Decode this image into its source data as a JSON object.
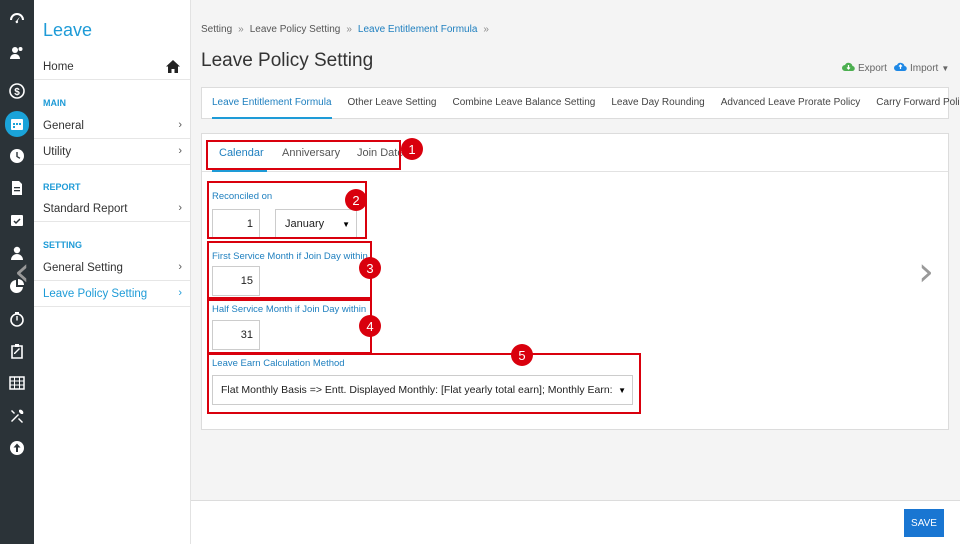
{
  "iconbar": {
    "icons": [
      "dashboard-icon",
      "people-icon",
      "dollar-icon",
      "calendar-icon",
      "clock-icon",
      "document-icon",
      "calendar-check-icon",
      "user-icon",
      "pie-chart-icon",
      "timer-icon",
      "clipboard-icon",
      "grid-icon",
      "tools-icon",
      "arrow-up-circle-icon"
    ],
    "active_index": 3
  },
  "sidebar": {
    "title": "Leave",
    "home": "Home",
    "main_header": "MAIN",
    "main_items": [
      "General",
      "Utility"
    ],
    "report_header": "REPORT",
    "report_items": [
      "Standard Report"
    ],
    "setting_header": "SETTING",
    "setting_items": [
      "General Setting",
      "Leave Policy Setting"
    ],
    "chevron": "›"
  },
  "breadcrumb": {
    "items": [
      "Setting",
      "Leave Policy Setting",
      "Leave Entitlement Formula"
    ],
    "separator": "»"
  },
  "page_title": "Leave Policy Setting",
  "actions": {
    "export_label": "Export",
    "import_label": "Import"
  },
  "tabs": [
    "Leave Entitlement Formula",
    "Other Leave Setting",
    "Combine Leave Balance Setting",
    "Leave Day Rounding",
    "Advanced Leave Prorate Policy",
    "Carry Forward Policy"
  ],
  "subtabs": [
    "Calendar",
    "Anniversary",
    "Join Date"
  ],
  "form": {
    "reconciled_label": "Reconciled on",
    "reconciled_day": "1",
    "reconciled_month": "January",
    "first_service_label": "First Service Month if Join Day within",
    "first_service_value": "15",
    "half_service_label": "Half Service Month if Join Day within",
    "half_service_value": "31",
    "calc_method_label": "Leave Earn Calculation Method",
    "calc_method_value": "Flat Monthly Basis => Entt. Displayed Monthly: [Flat yearly total earn]; Monthly Earn: [Fla"
  },
  "badges": [
    "1",
    "2",
    "3",
    "4",
    "5"
  ],
  "footer": {
    "save_label": "SAVE"
  },
  "nav": {
    "prev": "‹",
    "next": "›"
  },
  "colors": {
    "accent": "#1e9bd7",
    "annotation": "#d9000d",
    "save": "#1976d2",
    "iconbar": "#2b3338"
  }
}
